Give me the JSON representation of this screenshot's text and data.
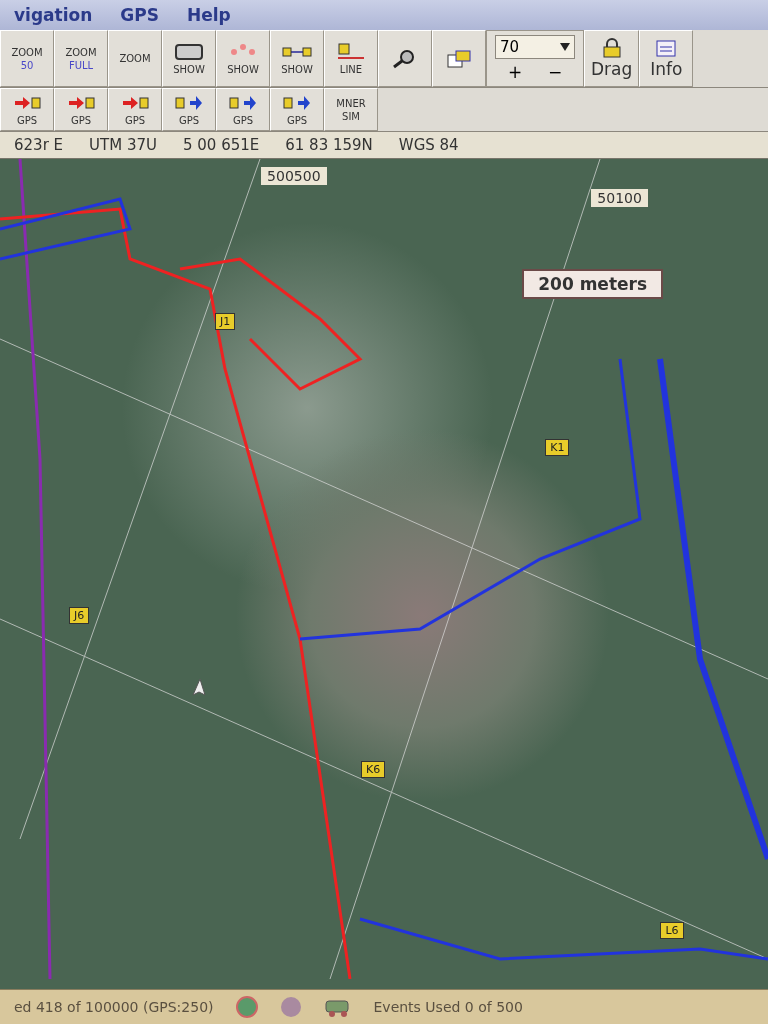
{
  "menu_bar": {
    "items": [
      "vigation",
      "GPS",
      "Help"
    ]
  },
  "toolbar": {
    "rows": [
      [
        {
          "kind": "zoom",
          "lines": [
            "ZOOM",
            "50"
          ]
        },
        {
          "kind": "zoom",
          "lines": [
            "ZOOM",
            "FULL"
          ]
        },
        {
          "kind": "zoom",
          "lines": [
            "ZOOM"
          ]
        },
        {
          "kind": "screen",
          "lines": [
            "SHOW"
          ]
        },
        {
          "kind": "dots",
          "lines": [
            "SHOW"
          ]
        },
        {
          "kind": "link",
          "lines": [
            "SHOW"
          ]
        },
        {
          "kind": "line",
          "lines": [
            "LINE"
          ]
        },
        {
          "kind": "search"
        },
        {
          "kind": "layers"
        },
        {
          "kind": "zoom_select",
          "value": "70",
          "plus": "+",
          "minus": "−"
        },
        {
          "kind": "lock",
          "lines": [
            "Drag"
          ]
        },
        {
          "kind": "info",
          "lines": [
            "Info"
          ]
        }
      ],
      [
        {
          "kind": "gps_send",
          "lines": [
            "GPS"
          ]
        },
        {
          "kind": "gps_send",
          "lines": [
            "GPS"
          ]
        },
        {
          "kind": "gps_send",
          "lines": [
            "GPS"
          ]
        },
        {
          "kind": "gps_receive",
          "lines": [
            "GPS"
          ]
        },
        {
          "kind": "gps_receive",
          "lines": [
            "GPS"
          ]
        },
        {
          "kind": "gps_receive",
          "lines": [
            "GPS"
          ]
        },
        {
          "kind": "text",
          "lines": [
            "MNER",
            "SIM"
          ]
        }
      ]
    ]
  },
  "coordinate_bar": {
    "fields": [
      "623r E",
      "UTM 37U",
      "5 00 651E",
      "61 83 159N",
      "WGS 84"
    ]
  },
  "map": {
    "grid_labels": [
      "500500",
      "50100"
    ],
    "scale": "200 meters",
    "waypoints": [
      "J1",
      "K1",
      "J6",
      "K6",
      "L6"
    ]
  },
  "status_bar": {
    "tracks": "ed 418 of 100000 (GPS:250)",
    "events": "Events Used 0 of 500"
  }
}
